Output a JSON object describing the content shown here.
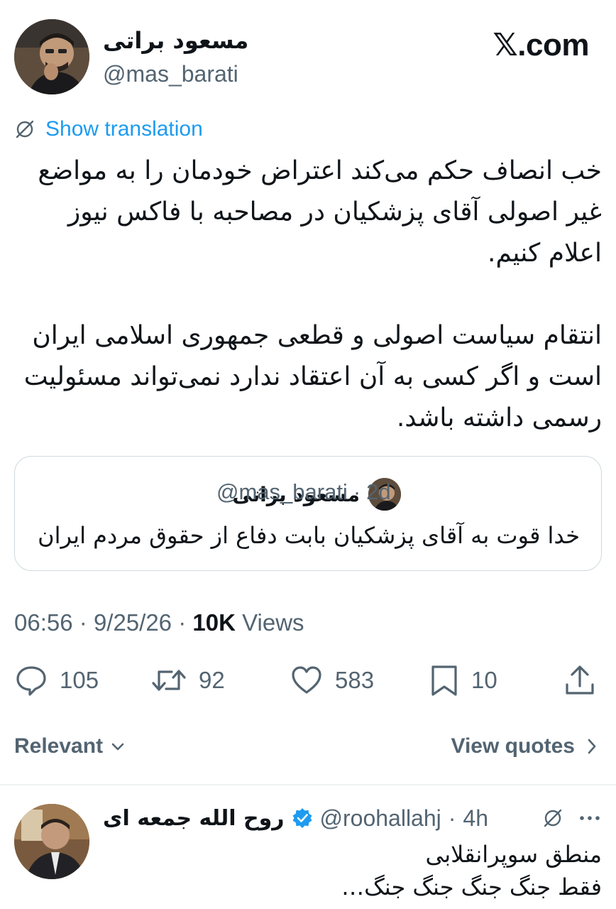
{
  "header": {
    "author_name": "مسعود براتی",
    "author_handle": "@mas_barati",
    "brand": "𝕏.com"
  },
  "translate": {
    "label": "Show translation",
    "icon": "globe-slash-icon",
    "color": "#1d9bf0"
  },
  "tweet": {
    "text": "خب انصاف حکم می‌کند اعتراض خودمان را به مواضع غیر اصولی آقای پزشکیان در مصاحبه با فاکس نیوز اعلام کنیم.\n\nانتقام سیاست اصولی و قطعی جمهوری اسلامی ایران است و اگر کسی به آن اعتقاد ندارد نمی‌تواند مسئولیت رسمی داشته باشد."
  },
  "quote": {
    "name": "مسعود براتی",
    "handle": "@mas_barati",
    "separator": "·",
    "time": "2d",
    "text": "خدا قوت به آقای پزشکیان بابت دفاع از حقوق مردم ایران"
  },
  "meta": {
    "time": "06:56",
    "sep1": "·",
    "date": "9/25/26",
    "sep2": "·",
    "views_count": "10K",
    "views_label": "Views"
  },
  "actions": {
    "replies": "105",
    "reposts": "92",
    "likes": "583",
    "bookmarks": "10"
  },
  "sort": {
    "label": "Relevant",
    "view_quotes": "View quotes"
  },
  "reply": {
    "name": "روح الله جمعه ای",
    "verified": true,
    "handle": "@roohallahj",
    "separator": "·",
    "time": "4h",
    "text": "منطق سوپرانقلابی\nفقط جنگ جنگ جنگ جنگ…"
  },
  "colors": {
    "text": "#0f1419",
    "secondary": "#536471",
    "accent": "#1d9bf0",
    "border": "#cfd9de"
  }
}
